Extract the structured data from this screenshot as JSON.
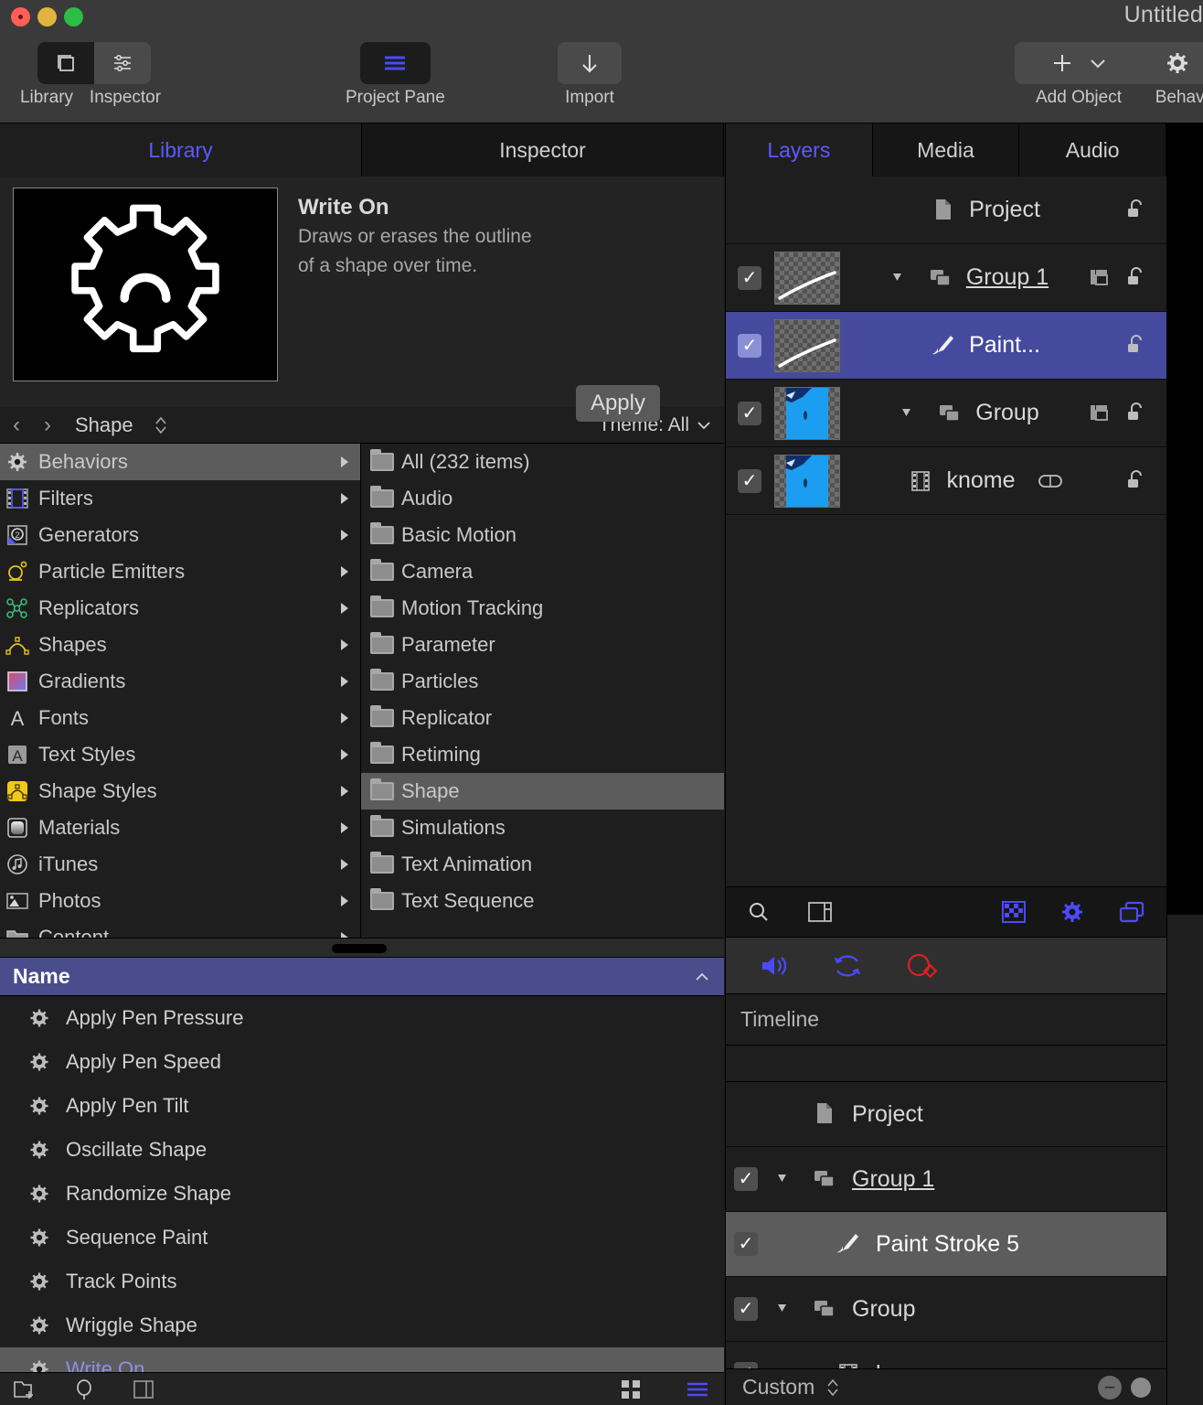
{
  "window": {
    "title": "Untitled"
  },
  "toolbar": {
    "items": [
      {
        "label": "Library",
        "icon": "library-icon"
      },
      {
        "label": "Inspector",
        "icon": "sliders-icon"
      },
      {
        "label": "Project Pane",
        "icon": "lines-icon"
      },
      {
        "label": "Import",
        "icon": "download-arrow-icon"
      },
      {
        "label": "Add Object",
        "icon": "plus-icon"
      },
      {
        "label": "Behaviors",
        "icon": "gear-icon"
      }
    ]
  },
  "left_panel": {
    "tabs": [
      {
        "label": "Library",
        "active": true
      },
      {
        "label": "Inspector",
        "active": false
      }
    ],
    "preview": {
      "title": "Write On",
      "description_line1": "Draws or erases the outline",
      "description_line2": "of a shape over time.",
      "apply_label": "Apply",
      "thumbnail_icon": "gear-outline-thumbnail"
    },
    "nav": {
      "back_icon": "chevron-left-icon",
      "forward_icon": "chevron-right-icon",
      "path": "Shape",
      "stepper_icon": "up-down-stepper-icon",
      "theme_label": "Theme: All",
      "theme_chevron": "chevron-down-icon"
    },
    "categories": [
      {
        "label": "Behaviors",
        "icon": "gear-icon",
        "selected": true
      },
      {
        "label": "Filters",
        "icon": "filmstrip-icon",
        "selected": false
      },
      {
        "label": "Generators",
        "icon": "generator-icon",
        "selected": false
      },
      {
        "label": "Particle Emitters",
        "icon": "particle-emitter-icon",
        "selected": false
      },
      {
        "label": "Replicators",
        "icon": "replicator-icon",
        "selected": false
      },
      {
        "label": "Shapes",
        "icon": "shape-curve-icon",
        "selected": false
      },
      {
        "label": "Gradients",
        "icon": "gradient-icon",
        "selected": false
      },
      {
        "label": "Fonts",
        "icon": "font-a-icon",
        "selected": false
      },
      {
        "label": "Text Styles",
        "icon": "text-style-icon",
        "selected": false
      },
      {
        "label": "Shape Styles",
        "icon": "shape-style-icon",
        "selected": false
      },
      {
        "label": "Materials",
        "icon": "material-icon",
        "selected": false
      },
      {
        "label": "iTunes",
        "icon": "itunes-note-icon",
        "selected": false
      },
      {
        "label": "Photos",
        "icon": "photos-icon",
        "selected": false
      },
      {
        "label": "Content",
        "icon": "folder-icon",
        "selected": false
      }
    ],
    "subcategories": [
      {
        "label": "All (232 items)",
        "selected": false
      },
      {
        "label": "Audio",
        "selected": false
      },
      {
        "label": "Basic Motion",
        "selected": false
      },
      {
        "label": "Camera",
        "selected": false
      },
      {
        "label": "Motion Tracking",
        "selected": false
      },
      {
        "label": "Parameter",
        "selected": false
      },
      {
        "label": "Particles",
        "selected": false
      },
      {
        "label": "Replicator",
        "selected": false
      },
      {
        "label": "Retiming",
        "selected": false
      },
      {
        "label": "Shape",
        "selected": true
      },
      {
        "label": "Simulations",
        "selected": false
      },
      {
        "label": "Text Animation",
        "selected": false
      },
      {
        "label": "Text Sequence",
        "selected": false
      }
    ],
    "name_header": {
      "label": "Name",
      "sort_icon": "chevron-up-icon"
    },
    "behaviors": [
      {
        "label": "Apply Pen Pressure",
        "selected": false
      },
      {
        "label": "Apply Pen Speed",
        "selected": false
      },
      {
        "label": "Apply Pen Tilt",
        "selected": false
      },
      {
        "label": "Oscillate Shape",
        "selected": false
      },
      {
        "label": "Randomize Shape",
        "selected": false
      },
      {
        "label": "Sequence Paint",
        "selected": false
      },
      {
        "label": "Track Points",
        "selected": false
      },
      {
        "label": "Wriggle Shape",
        "selected": false
      },
      {
        "label": "Write On",
        "selected": true
      }
    ],
    "bottom_bar": {
      "left_icons": [
        "new-folder-icon",
        "search-icon",
        "sidebar-toggle-icon"
      ],
      "right_icons": [
        "grid-view-icon",
        "list-view-icon"
      ]
    }
  },
  "right_panel": {
    "tabs": [
      {
        "label": "Layers",
        "active": true
      },
      {
        "label": "Media",
        "active": false
      },
      {
        "label": "Audio",
        "active": false
      }
    ],
    "layers": [
      {
        "name": "Project",
        "icon": "document-icon",
        "checkbox": null,
        "thumb": null,
        "selected": false,
        "lock": "unlock-icon",
        "link": false,
        "disclosure": null,
        "mask": false
      },
      {
        "name": "Group 1",
        "icon": "group-icon",
        "checkbox": true,
        "thumb": "stroke-thumb",
        "selected": false,
        "lock": "unlock-icon",
        "link": true,
        "disclosure": "expanded",
        "mask": true
      },
      {
        "name": "Paint...",
        "icon": "paintbrush-icon",
        "checkbox": true,
        "thumb": "stroke-thumb",
        "selected": true,
        "lock": "unlock-icon",
        "link": false,
        "disclosure": null,
        "mask": false
      },
      {
        "name": "Group",
        "icon": "group-icon",
        "checkbox": true,
        "thumb": "photo-thumb",
        "selected": false,
        "lock": "unlock-icon",
        "link": false,
        "disclosure": "expanded",
        "mask": true
      },
      {
        "name": "knome",
        "icon": "filmstrip-clip-icon",
        "checkbox": true,
        "thumb": "photo-thumb",
        "selected": false,
        "lock": "unlock-icon",
        "link": false,
        "disclosure": null,
        "mask": false,
        "linkbadge": "link-icon"
      }
    ],
    "layers_toolbar": {
      "left_icons": [
        "search-icon",
        "window-layout-icon"
      ],
      "right_icons": [
        "checkerboard-icon",
        "gear-icon",
        "layers-stack-icon"
      ]
    },
    "transport": {
      "icons": [
        "speaker-icon",
        "loop-icon",
        "record-keyframe-icon"
      ],
      "record_color": "#e02020",
      "accent_color": "#5b5bff"
    },
    "timeline": {
      "header_label": "Timeline",
      "rows": [
        {
          "name": "Project",
          "icon": "document-icon",
          "checkbox": null,
          "selected": false,
          "disclosure": null,
          "link": false
        },
        {
          "name": "Group 1",
          "icon": "group-icon",
          "checkbox": true,
          "selected": false,
          "disclosure": "expanded",
          "link": true
        },
        {
          "name": "Paint Stroke 5",
          "icon": "paintbrush-icon",
          "checkbox": true,
          "selected": true,
          "disclosure": null,
          "link": false
        },
        {
          "name": "Group",
          "icon": "group-icon",
          "checkbox": true,
          "selected": false,
          "disclosure": "expanded",
          "link": false
        },
        {
          "name": "knome",
          "icon": "filmstrip-clip-icon",
          "checkbox": true,
          "selected": false,
          "disclosure": null,
          "link": false
        }
      ],
      "footer": {
        "label": "Custom",
        "stepper_icon": "up-down-stepper-icon",
        "zoom_out_icon": "zoom-out-icon"
      }
    }
  },
  "colors": {
    "accent": "#5b5bff",
    "selection_blue": "#454a9e",
    "selection_gray": "#5c5c5c",
    "header_blue": "#4a4d8c",
    "record_red": "#e02020"
  }
}
